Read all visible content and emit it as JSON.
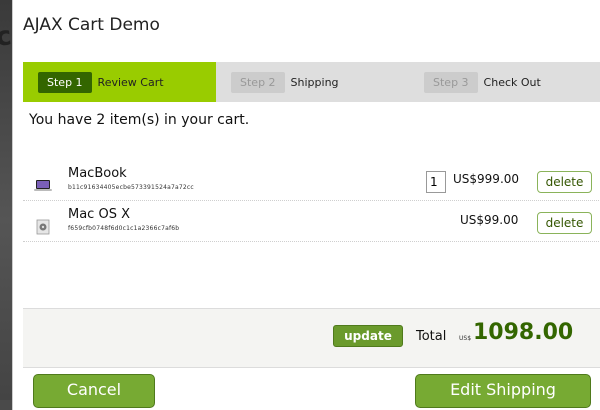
{
  "dialog": {
    "title": "AJAX Cart Demo"
  },
  "steps": [
    {
      "badge": "Step 1",
      "label": "Review Cart",
      "active": true
    },
    {
      "badge": "Step 2",
      "label": "Shipping",
      "active": false
    },
    {
      "badge": "Step 3",
      "label": "Check Out",
      "active": false
    }
  ],
  "cart": {
    "summary": "You have 2 item(s) in your cart.",
    "items": [
      {
        "name": "MacBook",
        "sku": "b11c91634405ecbe573391524a7a72cc",
        "quantity": "1",
        "price": "US$999.00",
        "delete_label": "delete",
        "icon": "laptop-icon"
      },
      {
        "name": "Mac OS X",
        "sku": "f659cfb0748f6d0c1c1a2366c7af6b",
        "price": "US$99.00",
        "delete_label": "delete",
        "icon": "software-box-icon"
      }
    ]
  },
  "footer": {
    "update_label": "update",
    "total_label": "Total",
    "total_currency": "US$",
    "total_value": "1098.00"
  },
  "actions": {
    "cancel_label": "Cancel",
    "edit_shipping_label": "Edit Shipping"
  },
  "colors": {
    "accent": "#99cc00",
    "active_badge": "#336600",
    "total": "#336600",
    "button": "#77aa33"
  }
}
